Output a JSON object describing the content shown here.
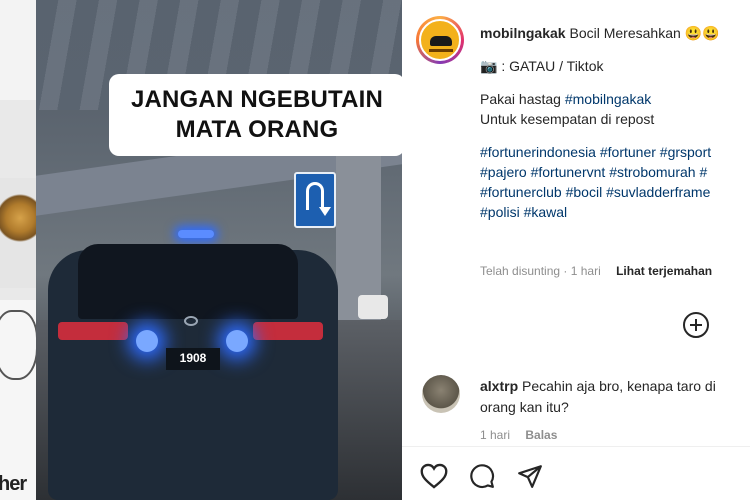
{
  "media": {
    "caption_line1": "JANGAN NGEBUTAIN",
    "caption_line2": "MATA ORANG",
    "plate_text": "1908"
  },
  "background": {
    "partial_text": "her"
  },
  "post": {
    "username": "mobilngakak",
    "title": "Bocil Meresahkan 😃😃",
    "source_line": "📷 : GATAU / Tiktok",
    "hashtag_line1": "Pakai hastag ",
    "hashtag_tag": "#mobilngakak",
    "hashtag_line2": "Untuk kesempatan di repost",
    "tags_line1": "#fortunerindonesia #fortuner #grsport",
    "tags_line2": "#pajero #fortunervnt #strobomurah #",
    "tags_line3": "#fortunerclub #bocil #suvladderframe",
    "tags_line4": "#polisi #kawal",
    "meta_edited": "Telah disunting · 1 hari",
    "see_translation": "Lihat terjemahan"
  },
  "comment": {
    "username": "alxtrp",
    "text_line1": "Pecahin aja bro, kenapa taro di",
    "text_line2": "orang kan itu?",
    "time": "1 hari",
    "reply": "Balas"
  },
  "icons": {
    "add": "add-circle-icon",
    "like": "heart-icon",
    "comment": "comment-icon",
    "share": "share-icon"
  }
}
